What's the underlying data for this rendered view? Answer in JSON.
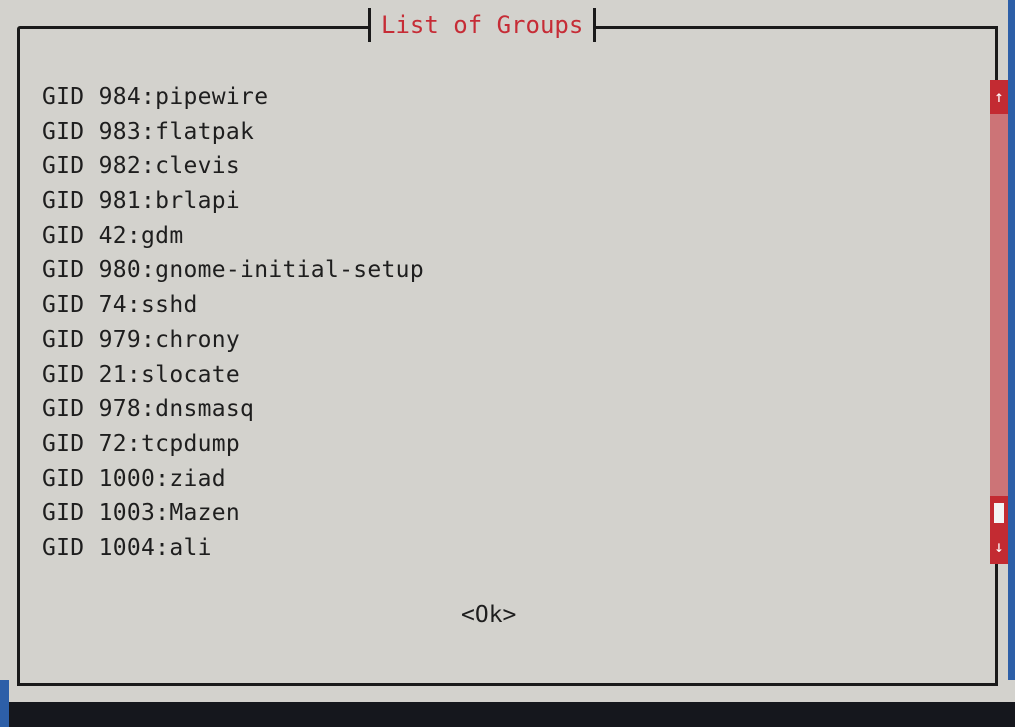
{
  "dialog": {
    "title": "List of Groups",
    "ok_label": "<Ok>"
  },
  "groups": [
    "GID 984:pipewire",
    "GID 983:flatpak",
    "GID 982:clevis",
    "GID 981:brlapi",
    "GID 42:gdm",
    "GID 980:gnome-initial-setup",
    "GID 74:sshd",
    "GID 979:chrony",
    "GID 21:slocate",
    "GID 978:dnsmasq",
    "GID 72:tcpdump",
    "GID 1000:ziad",
    "GID 1003:Mazen",
    "GID 1004:ali"
  ],
  "scrollbar": {
    "up_arrow": "↑",
    "down_arrow": "↓",
    "position_fraction": 0.9
  },
  "colors": {
    "background": "#d3d2cd",
    "title_text": "#c62c36",
    "scrollbar_track": "#cc7477",
    "scrollbar_accent": "#c32b32",
    "bottom_bar": "#15171d"
  }
}
